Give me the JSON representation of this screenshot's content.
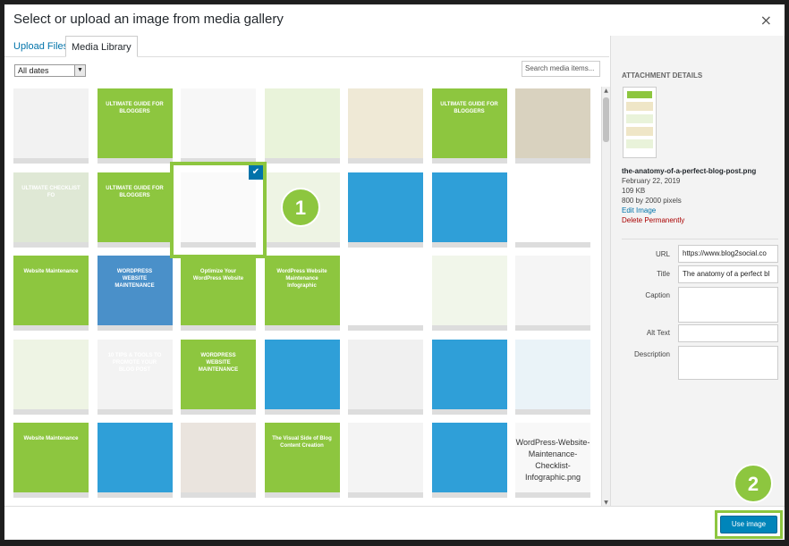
{
  "modal": {
    "title": "Select or upload an image from media gallery",
    "close_icon": "×"
  },
  "tabs": [
    {
      "label": "Upload Files",
      "active": false
    },
    {
      "label": "Media Library",
      "active": true
    }
  ],
  "toolbar": {
    "date_filter": "All dates",
    "search_placeholder": "Search media items..."
  },
  "grid": {
    "items": [
      {
        "name": "thumb-screenshot",
        "color": "#f2f2f2"
      },
      {
        "name": "thumb-ultimate-guide-1",
        "color": "#8dc63f",
        "text": "ULTIMATE GUIDE FOR BLOGGERS"
      },
      {
        "name": "thumb-infographic-white",
        "color": "#f7f7f7"
      },
      {
        "name": "thumb-green-flow",
        "color": "#e9f3da"
      },
      {
        "name": "thumb-infographic-beige",
        "color": "#efe9d6"
      },
      {
        "name": "thumb-ultimate-guide-2",
        "color": "#8dc63f",
        "text": "ULTIMATE GUIDE FOR BLOGGERS"
      },
      {
        "name": "thumb-note-paper",
        "color": "#d9d2bf"
      },
      {
        "name": "thumb-ultimate-checklist",
        "color": "#dfe8d5",
        "text": "ULTIMATE CHECKLIST FO"
      },
      {
        "name": "thumb-ultimate-guide-3",
        "color": "#8dc63f",
        "text": "ULTIMATE GUIDE FOR BLOGGERS"
      },
      {
        "name": "thumb-anatomy-selected",
        "color": "#fafafa"
      },
      {
        "name": "thumb-green-circles",
        "color": "#eef4e4"
      },
      {
        "name": "thumb-blue-infographic-1",
        "color": "#2f9fd8"
      },
      {
        "name": "thumb-blue-infographic-2",
        "color": "#2f9fd8"
      },
      {
        "name": "thumb-blue-tall",
        "color": "#ffffff"
      },
      {
        "name": "thumb-website-maintenance",
        "color": "#8dc63f",
        "text": "Website Maintenance"
      },
      {
        "name": "thumb-wordpress-blue",
        "color": "#4a90c9",
        "text": "WORDPRESS WEBSITE MAINTENANCE"
      },
      {
        "name": "thumb-optimize-wordpress",
        "color": "#8dc63f",
        "text": "Optimize Your WordPress Website"
      },
      {
        "name": "thumb-wordpress-maintenance-infographic",
        "color": "#8dc63f",
        "text": "WordPress Website Maintenance Infographic"
      },
      {
        "name": "thumb-portrait",
        "color": "#ffffff"
      },
      {
        "name": "thumb-green-nodes",
        "color": "#f1f6ea"
      },
      {
        "name": "thumb-hands",
        "color": "#f5f5f5"
      },
      {
        "name": "thumb-brain",
        "color": "#eef4e4"
      },
      {
        "name": "thumb-tips-tools",
        "color": "#f3f3f3",
        "text": "10 TIPS & TOOLS TO PROMOTE YOUR BLOG POST"
      },
      {
        "name": "thumb-wordpress-maint-2",
        "color": "#8dc63f",
        "text": "WORDPRESS WEBSITE MAINTENANCE"
      },
      {
        "name": "thumb-blue-doc",
        "color": "#2f9fd8"
      },
      {
        "name": "thumb-colorful-list",
        "color": "#f0f0f0"
      },
      {
        "name": "thumb-blue-infographic-3",
        "color": "#2f9fd8"
      },
      {
        "name": "thumb-blue-robots",
        "color": "#eaf3f8"
      },
      {
        "name": "thumb-website-maintenance-2",
        "color": "#8dc63f",
        "text": "Website Maintenance"
      },
      {
        "name": "thumb-blue-doc-2",
        "color": "#2f9fd8"
      },
      {
        "name": "thumb-woman",
        "color": "#eae4de"
      },
      {
        "name": "thumb-visual-side",
        "color": "#8dc63f",
        "text": "The Visual Side of Blog Content Creation"
      },
      {
        "name": "thumb-visuals-traffic",
        "color": "#f4f4f4"
      },
      {
        "name": "thumb-blue-infographic-4",
        "color": "#2f9fd8"
      },
      {
        "name": "thumb-file-placeholder",
        "color": "#f8f8f8",
        "filename": "WordPress-Website-Maintenance-Checklist-Infographic.png"
      }
    ]
  },
  "details": {
    "heading": "ATTACHMENT DETAILS",
    "filename": "the-anatomy-of-a-perfect-blog-post.png",
    "date": "February 22, 2019",
    "size": "109 KB",
    "dimensions": "800 by 2000 pixels",
    "edit_link": "Edit Image",
    "delete_link": "Delete Permanently",
    "fields": {
      "url_label": "URL",
      "url_value": "https://www.blog2social.co",
      "title_label": "Title",
      "title_value": "The anatomy of a perfect bl",
      "caption_label": "Caption",
      "alt_label": "Alt Text",
      "description_label": "Description"
    }
  },
  "footer": {
    "use_button": "Use image"
  },
  "steps": [
    "1",
    "2"
  ],
  "colors": {
    "accent": "#8dc63f",
    "primary": "#0085ba",
    "link": "#0073aa",
    "danger": "#aa0000"
  }
}
